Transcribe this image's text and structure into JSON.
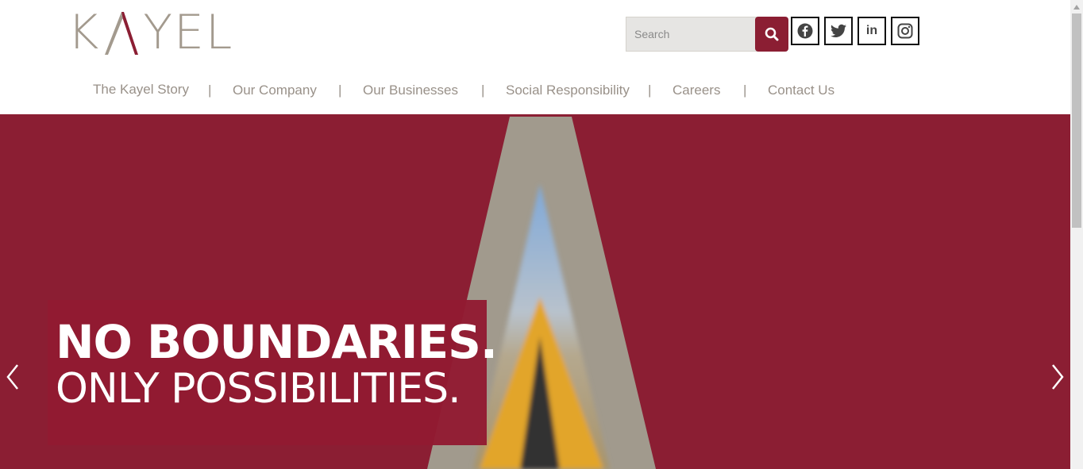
{
  "brand": {
    "logo_prefix": "K",
    "logo_suffix": "YEL",
    "logo_text": "KAYEL",
    "brand_color": "#8b1e33",
    "logo_color": "#a39a8e"
  },
  "search": {
    "placeholder": "Search",
    "value": "",
    "button_icon": "search-icon"
  },
  "social": [
    {
      "icon": "facebook-icon",
      "label": "Facebook"
    },
    {
      "icon": "twitter-icon",
      "label": "Twitter"
    },
    {
      "icon": "linkedin-icon",
      "label": "in"
    },
    {
      "icon": "instagram-icon",
      "label": "Instagram"
    }
  ],
  "nav": {
    "items": [
      {
        "label": "The Kayel Story"
      },
      {
        "label": "Our Company"
      },
      {
        "label": "Our Businesses"
      },
      {
        "label": "Social Responsibility"
      },
      {
        "label": "Careers"
      },
      {
        "label": "Contact Us"
      }
    ],
    "separator": "|"
  },
  "hero": {
    "headline": "NO BOUNDARIES.",
    "subheadline": "ONLY POSSIBILITIES.",
    "prev_icon": "chevron-left-icon",
    "next_icon": "chevron-right-icon"
  },
  "colors": {
    "hero_bg": "#8b1e33",
    "road_frame": "#a19a8d",
    "nav_text": "#999189"
  }
}
